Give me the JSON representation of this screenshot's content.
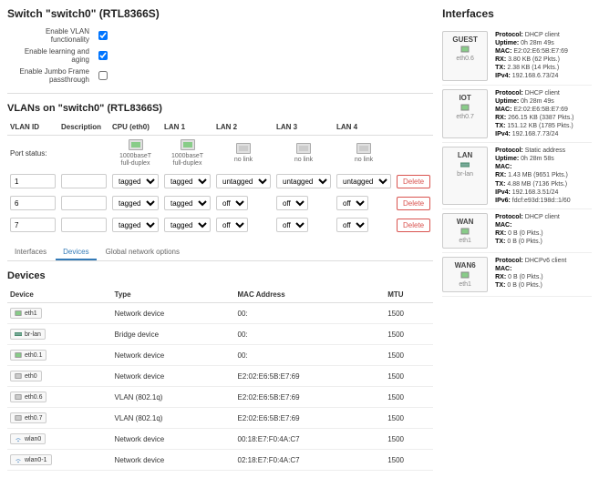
{
  "switch": {
    "title": "Switch \"switch0\" (RTL8366S)",
    "enable_vlan_label": "Enable VLAN functionality",
    "enable_vlan": true,
    "enable_learn_label": "Enable learning and aging",
    "enable_learn": true,
    "enable_jumbo_label": "Enable Jumbo Frame passthrough",
    "enable_jumbo": false
  },
  "vlans": {
    "title": "VLANs on \"switch0\" (RTL8366S)",
    "cols": [
      "VLAN ID",
      "Description",
      "CPU (eth0)",
      "LAN 1",
      "LAN 2",
      "LAN 3",
      "LAN 4",
      ""
    ],
    "portstatus_label": "Port status:",
    "ports": [
      {
        "label1": "1000baseT",
        "label2": "full-duplex",
        "active": true
      },
      {
        "label1": "1000baseT",
        "label2": "full-duplex",
        "active": true
      },
      {
        "label1": "no link",
        "label2": "",
        "active": false
      },
      {
        "label1": "no link",
        "label2": "",
        "active": false
      },
      {
        "label1": "no link",
        "label2": "",
        "active": false
      }
    ],
    "rows": [
      {
        "id": "1",
        "desc": "",
        "v": [
          "tagged",
          "tagged",
          "untagged",
          "untagged",
          "untagged"
        ],
        "del": "Delete"
      },
      {
        "id": "6",
        "desc": "",
        "v": [
          "tagged",
          "tagged",
          "off",
          "off",
          "off"
        ],
        "del": "Delete"
      },
      {
        "id": "7",
        "desc": "",
        "v": [
          "tagged",
          "tagged",
          "off",
          "off",
          "off"
        ],
        "del": "Delete"
      }
    ]
  },
  "tabs": [
    "Interfaces",
    "Devices",
    "Global network options"
  ],
  "tabs_active": 1,
  "devices": {
    "title": "Devices",
    "cols": [
      "Device",
      "Type",
      "MAC Address",
      "MTU"
    ],
    "rows": [
      {
        "name": "eth1",
        "type": "Network device",
        "mac": "00:",
        "mtu": "1500",
        "ico": "port"
      },
      {
        "name": "br-lan",
        "type": "Bridge device",
        "mac": "00:",
        "mtu": "1500",
        "ico": "bridge"
      },
      {
        "name": "eth0.1",
        "type": "Network device",
        "mac": "00:",
        "mtu": "1500",
        "ico": "vlan"
      },
      {
        "name": "eth0",
        "type": "Network device",
        "mac": "E2:02:E6:5B:E7:69",
        "mtu": "1500",
        "ico": "port-off"
      },
      {
        "name": "eth0.6",
        "type": "VLAN (802.1q)",
        "mac": "E2:02:E6:5B:E7:69",
        "mtu": "1500",
        "ico": "vlan-off"
      },
      {
        "name": "eth0.7",
        "type": "VLAN (802.1q)",
        "mac": "E2:02:E6:5B:E7:69",
        "mtu": "1500",
        "ico": "vlan-off"
      },
      {
        "name": "wlan0",
        "type": "Network device",
        "mac": "00:18:E7:F0:4A:C7",
        "mtu": "1500",
        "ico": "wifi"
      },
      {
        "name": "wlan0-1",
        "type": "Network device",
        "mac": "02:18:E7:F0:4A:C7",
        "mtu": "1500",
        "ico": "wifi"
      }
    ]
  },
  "interfaces": {
    "title": "Interfaces",
    "items": [
      {
        "name": "GUEST",
        "dev": "eth0.6",
        "ico": "vlan",
        "info": [
          [
            "Protocol",
            "DHCP client"
          ],
          [
            "Uptime",
            "0h 28m 49s"
          ],
          [
            "MAC",
            "E2:02:E6:5B:E7:69"
          ],
          [
            "RX",
            "3.80 KB (62 Pkts.)"
          ],
          [
            "TX",
            "2.38 KB (14 Pkts.)"
          ],
          [
            "IPv4",
            "192.168.6.73/24"
          ]
        ]
      },
      {
        "name": "IOT",
        "dev": "eth0.7",
        "ico": "vlan",
        "info": [
          [
            "Protocol",
            "DHCP client"
          ],
          [
            "Uptime",
            "0h 28m 49s"
          ],
          [
            "MAC",
            "E2:02:E6:5B:E7:69"
          ],
          [
            "RX",
            "266.15 KB (3387 Pkts.)"
          ],
          [
            "TX",
            "151.12 KB (1785 Pkts.)"
          ],
          [
            "IPv4",
            "192.168.7.73/24"
          ]
        ]
      },
      {
        "name": "LAN",
        "dev": "br-lan",
        "ico": "bridge",
        "info": [
          [
            "Protocol",
            "Static address"
          ],
          [
            "Uptime",
            "0h 28m 58s"
          ],
          [
            "MAC",
            ""
          ],
          [
            "RX",
            "1.43 MB (9651 Pkts.)"
          ],
          [
            "TX",
            "4.88 MB (7136 Pkts.)"
          ],
          [
            "IPv4",
            "192.168.3.51/24"
          ],
          [
            "IPv6",
            "fdcf:e93d:198d::1/60"
          ]
        ]
      },
      {
        "name": "WAN",
        "dev": "eth1",
        "ico": "port",
        "info": [
          [
            "Protocol",
            "DHCP client"
          ],
          [
            "MAC",
            ""
          ],
          [
            "RX",
            "0 B (0 Pkts.)"
          ],
          [
            "TX",
            "0 B (0 Pkts.)"
          ]
        ]
      },
      {
        "name": "WAN6",
        "dev": "eth1",
        "ico": "port",
        "info": [
          [
            "Protocol",
            "DHCPv6 client"
          ],
          [
            "MAC",
            ""
          ],
          [
            "RX",
            "0 B (0 Pkts.)"
          ],
          [
            "TX",
            "0 B (0 Pkts.)"
          ]
        ]
      }
    ]
  }
}
